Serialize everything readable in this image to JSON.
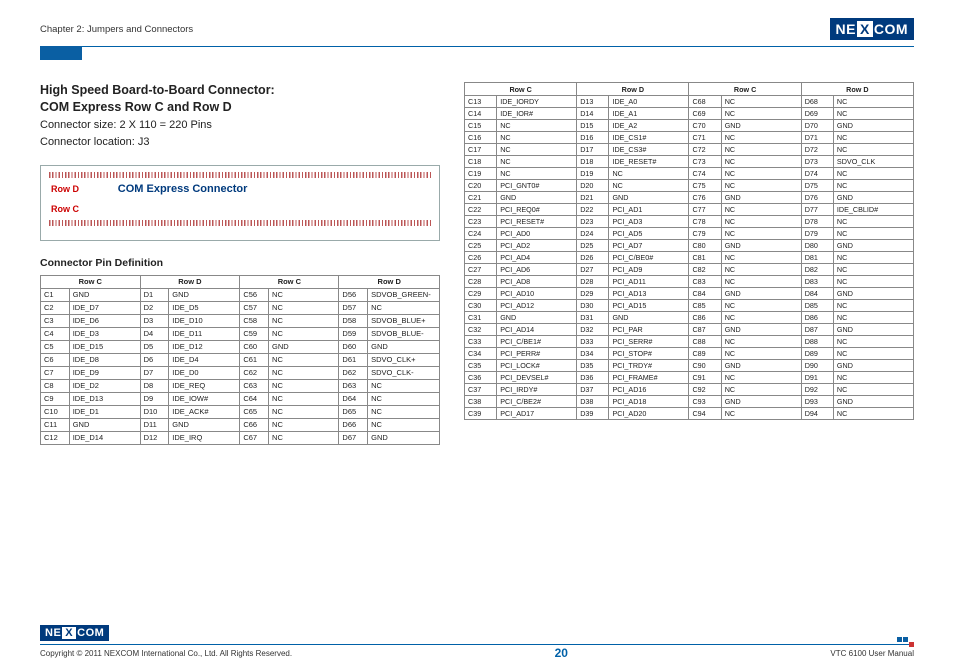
{
  "header": {
    "chapter": "Chapter 2: Jumpers and Connectors",
    "brand": "NE",
    "brand_x": "X",
    "brand2": "COM"
  },
  "section": {
    "title1": "High Speed Board-to-Board Connector:",
    "title2": "COM Express Row C and Row D",
    "sub1": "Connector size: 2 X 110 = 220 Pins",
    "sub2": "Connector location: J3"
  },
  "diagram": {
    "row_d": "Row D",
    "row_c": "Row C",
    "title": "COM Express Connector"
  },
  "pin_def_title": "Connector Pin Definition",
  "table_headers": {
    "rowC": "Row C",
    "rowD": "Row D"
  },
  "left_table": [
    [
      "C1",
      "GND",
      "D1",
      "GND",
      "C56",
      "NC",
      "D56",
      "SDVOB_GREEN-"
    ],
    [
      "C2",
      "IDE_D7",
      "D2",
      "IDE_D5",
      "C57",
      "NC",
      "D57",
      "NC"
    ],
    [
      "C3",
      "IDE_D6",
      "D3",
      "IDE_D10",
      "C58",
      "NC",
      "D58",
      "SDVOB_BLUE+"
    ],
    [
      "C4",
      "IDE_D3",
      "D4",
      "IDE_D11",
      "C59",
      "NC",
      "D59",
      "SDVOB_BLUE-"
    ],
    [
      "C5",
      "IDE_D15",
      "D5",
      "IDE_D12",
      "C60",
      "GND",
      "D60",
      "GND"
    ],
    [
      "C6",
      "IDE_D8",
      "D6",
      "IDE_D4",
      "C61",
      "NC",
      "D61",
      "SDVO_CLK+"
    ],
    [
      "C7",
      "IDE_D9",
      "D7",
      "IDE_D0",
      "C62",
      "NC",
      "D62",
      "SDVO_CLK-"
    ],
    [
      "C8",
      "IDE_D2",
      "D8",
      "IDE_REQ",
      "C63",
      "NC",
      "D63",
      "NC"
    ],
    [
      "C9",
      "IDE_D13",
      "D9",
      "IDE_IOW#",
      "C64",
      "NC",
      "D64",
      "NC"
    ],
    [
      "C10",
      "IDE_D1",
      "D10",
      "IDE_ACK#",
      "C65",
      "NC",
      "D65",
      "NC"
    ],
    [
      "C11",
      "GND",
      "D11",
      "GND",
      "C66",
      "NC",
      "D66",
      "NC"
    ],
    [
      "C12",
      "IDE_D14",
      "D12",
      "IDE_IRQ",
      "C67",
      "NC",
      "D67",
      "GND"
    ]
  ],
  "right_table": [
    [
      "C13",
      "IDE_IORDY",
      "D13",
      "IDE_A0",
      "C68",
      "NC",
      "D68",
      "NC"
    ],
    [
      "C14",
      "IDE_IOR#",
      "D14",
      "IDE_A1",
      "C69",
      "NC",
      "D69",
      "NC"
    ],
    [
      "C15",
      "NC",
      "D15",
      "IDE_A2",
      "C70",
      "GND",
      "D70",
      "GND"
    ],
    [
      "C16",
      "NC",
      "D16",
      "IDE_CS1#",
      "C71",
      "NC",
      "D71",
      "NC"
    ],
    [
      "C17",
      "NC",
      "D17",
      "IDE_CS3#",
      "C72",
      "NC",
      "D72",
      "NC"
    ],
    [
      "C18",
      "NC",
      "D18",
      "IDE_RESET#",
      "C73",
      "NC",
      "D73",
      "SDVO_CLK"
    ],
    [
      "C19",
      "NC",
      "D19",
      "NC",
      "C74",
      "NC",
      "D74",
      "NC"
    ],
    [
      "C20",
      "PCI_GNT0#",
      "D20",
      "NC",
      "C75",
      "NC",
      "D75",
      "NC"
    ],
    [
      "C21",
      "GND",
      "D21",
      "GND",
      "C76",
      "GND",
      "D76",
      "GND"
    ],
    [
      "C22",
      "PCI_REQ0#",
      "D22",
      "PCI_AD1",
      "C77",
      "NC",
      "D77",
      "IDE_CBLID#"
    ],
    [
      "C23",
      "PCI_RESET#",
      "D23",
      "PCI_AD3",
      "C78",
      "NC",
      "D78",
      "NC"
    ],
    [
      "C24",
      "PCI_AD0",
      "D24",
      "PCI_AD5",
      "C79",
      "NC",
      "D79",
      "NC"
    ],
    [
      "C25",
      "PCI_AD2",
      "D25",
      "PCI_AD7",
      "C80",
      "GND",
      "D80",
      "GND"
    ],
    [
      "C26",
      "PCI_AD4",
      "D26",
      "PCI_C/BE0#",
      "C81",
      "NC",
      "D81",
      "NC"
    ],
    [
      "C27",
      "PCI_AD6",
      "D27",
      "PCI_AD9",
      "C82",
      "NC",
      "D82",
      "NC"
    ],
    [
      "C28",
      "PCI_AD8",
      "D28",
      "PCI_AD11",
      "C83",
      "NC",
      "D83",
      "NC"
    ],
    [
      "C29",
      "PCI_AD10",
      "D29",
      "PCI_AD13",
      "C84",
      "GND",
      "D84",
      "GND"
    ],
    [
      "C30",
      "PCI_AD12",
      "D30",
      "PCI_AD15",
      "C85",
      "NC",
      "D85",
      "NC"
    ],
    [
      "C31",
      "GND",
      "D31",
      "GND",
      "C86",
      "NC",
      "D86",
      "NC"
    ],
    [
      "C32",
      "PCI_AD14",
      "D32",
      "PCI_PAR",
      "C87",
      "GND",
      "D87",
      "GND"
    ],
    [
      "C33",
      "PCI_C/BE1#",
      "D33",
      "PCI_SERR#",
      "C88",
      "NC",
      "D88",
      "NC"
    ],
    [
      "C34",
      "PCI_PERR#",
      "D34",
      "PCI_STOP#",
      "C89",
      "NC",
      "D89",
      "NC"
    ],
    [
      "C35",
      "PCI_LOCK#",
      "D35",
      "PCI_TRDY#",
      "C90",
      "GND",
      "D90",
      "GND"
    ],
    [
      "C36",
      "PCI_DEVSEL#",
      "D36",
      "PCI_FRAME#",
      "C91",
      "NC",
      "D91",
      "NC"
    ],
    [
      "C37",
      "PCI_IRDY#",
      "D37",
      "PCI_AD16",
      "C92",
      "NC",
      "D92",
      "NC"
    ],
    [
      "C38",
      "PCI_C/BE2#",
      "D38",
      "PCI_AD18",
      "C93",
      "GND",
      "D93",
      "GND"
    ],
    [
      "C39",
      "PCI_AD17",
      "D39",
      "PCI_AD20",
      "C94",
      "NC",
      "D94",
      "NC"
    ]
  ],
  "footer": {
    "copyright": "Copyright © 2011 NEXCOM International Co., Ltd. All Rights Reserved.",
    "page": "20",
    "manual": "VTC 6100 User Manual"
  }
}
